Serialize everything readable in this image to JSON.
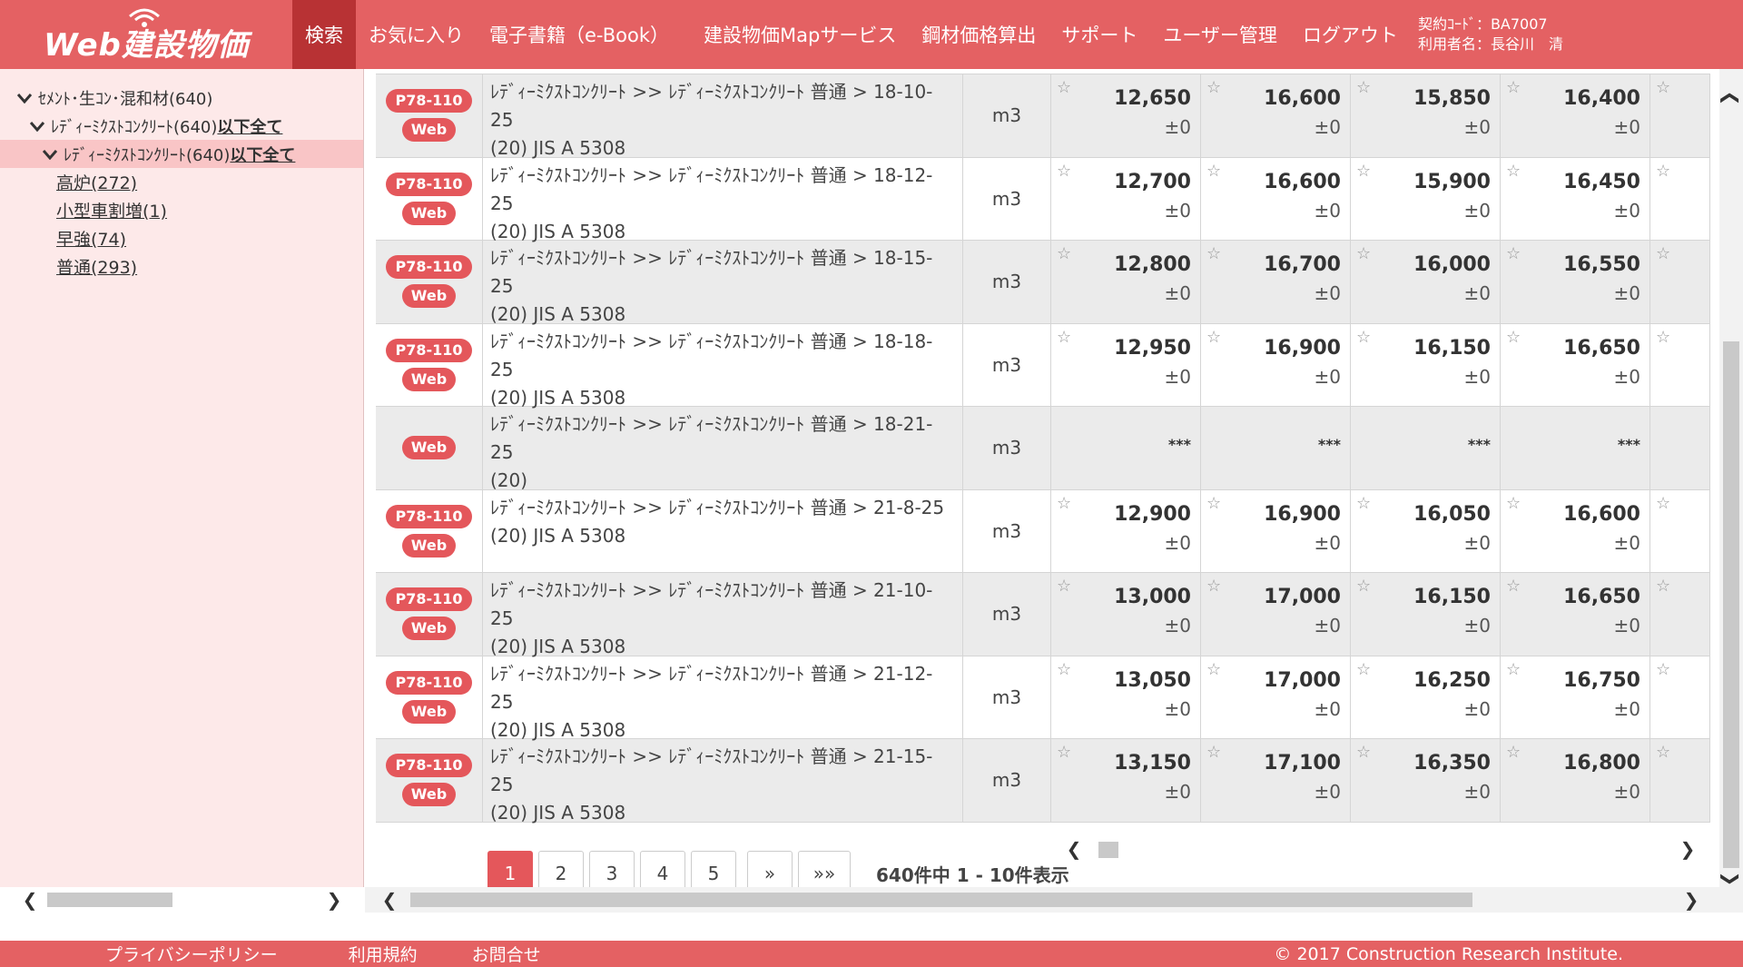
{
  "header": {
    "logo": "Web建設物価",
    "nav": [
      "検索",
      "お気に入り",
      "電子書籍（e-Book）",
      "建設物価Mapサービス",
      "鋼材価格算出",
      "サポート",
      "ユーザー管理",
      "ログアウト"
    ],
    "contract_code": "契約ｺｰﾄﾞ：BA7007",
    "user_name": "利用者名：長谷川　清"
  },
  "sidebar": {
    "root": "ｾﾒﾝﾄ･生ｺﾝ･混和材(640)",
    "level1": "ﾚﾃﾞｨｰﾐｸｽﾄｺﾝｸﾘｰﾄ(640)",
    "level1_link": " 以下全て",
    "level2": "ﾚﾃﾞｨｰﾐｸｽﾄｺﾝｸﾘｰﾄ(640)",
    "level2_link": " 以下全て",
    "leaves": [
      "高炉(272)",
      "小型車割増(1)",
      "早強(74)",
      "普通(293)"
    ]
  },
  "rows": [
    {
      "badges": [
        "P78-110",
        "Web"
      ],
      "desc1": "ﾚﾃﾞｨｰﾐｸｽﾄｺﾝｸﾘｰﾄ >> ﾚﾃﾞｨｰﾐｸｽﾄｺﾝｸﾘｰﾄ 普通 > 18-10-25",
      "desc2": "(20) JIS A 5308",
      "unit": "m3",
      "prices": [
        "12,650",
        "16,600",
        "15,850",
        "16,400"
      ],
      "diffs": [
        "±0",
        "±0",
        "±0",
        "±0"
      ]
    },
    {
      "badges": [
        "P78-110",
        "Web"
      ],
      "desc1": "ﾚﾃﾞｨｰﾐｸｽﾄｺﾝｸﾘｰﾄ >> ﾚﾃﾞｨｰﾐｸｽﾄｺﾝｸﾘｰﾄ 普通 > 18-12-25",
      "desc2": "(20) JIS A 5308",
      "unit": "m3",
      "prices": [
        "12,700",
        "16,600",
        "15,900",
        "16,450"
      ],
      "diffs": [
        "±0",
        "±0",
        "±0",
        "±0"
      ]
    },
    {
      "badges": [
        "P78-110",
        "Web"
      ],
      "desc1": "ﾚﾃﾞｨｰﾐｸｽﾄｺﾝｸﾘｰﾄ >> ﾚﾃﾞｨｰﾐｸｽﾄｺﾝｸﾘｰﾄ 普通 > 18-15-25",
      "desc2": "(20) JIS A 5308",
      "unit": "m3",
      "prices": [
        "12,800",
        "16,700",
        "16,000",
        "16,550"
      ],
      "diffs": [
        "±0",
        "±0",
        "±0",
        "±0"
      ]
    },
    {
      "badges": [
        "P78-110",
        "Web"
      ],
      "desc1": "ﾚﾃﾞｨｰﾐｸｽﾄｺﾝｸﾘｰﾄ >> ﾚﾃﾞｨｰﾐｸｽﾄｺﾝｸﾘｰﾄ 普通 > 18-18-25",
      "desc2": "(20) JIS A 5308",
      "unit": "m3",
      "prices": [
        "12,950",
        "16,900",
        "16,150",
        "16,650"
      ],
      "diffs": [
        "±0",
        "±0",
        "±0",
        "±0"
      ]
    },
    {
      "badges": [
        "Web"
      ],
      "desc1": "ﾚﾃﾞｨｰﾐｸｽﾄｺﾝｸﾘｰﾄ >> ﾚﾃﾞｨｰﾐｸｽﾄｺﾝｸﾘｰﾄ 普通 > 18-21-25",
      "desc2": "(20)",
      "unit": "m3",
      "masked": "***"
    },
    {
      "badges": [
        "P78-110",
        "Web"
      ],
      "desc1": "ﾚﾃﾞｨｰﾐｸｽﾄｺﾝｸﾘｰﾄ >> ﾚﾃﾞｨｰﾐｸｽﾄｺﾝｸﾘｰﾄ 普通 > 21-8-25",
      "desc2": "(20) JIS A 5308",
      "unit": "m3",
      "prices": [
        "12,900",
        "16,900",
        "16,050",
        "16,600"
      ],
      "diffs": [
        "±0",
        "±0",
        "±0",
        "±0"
      ]
    },
    {
      "badges": [
        "P78-110",
        "Web"
      ],
      "desc1": "ﾚﾃﾞｨｰﾐｸｽﾄｺﾝｸﾘｰﾄ >> ﾚﾃﾞｨｰﾐｸｽﾄｺﾝｸﾘｰﾄ 普通 > 21-10-25",
      "desc2": "(20) JIS A 5308",
      "unit": "m3",
      "prices": [
        "13,000",
        "17,000",
        "16,150",
        "16,650"
      ],
      "diffs": [
        "±0",
        "±0",
        "±0",
        "±0"
      ]
    },
    {
      "badges": [
        "P78-110",
        "Web"
      ],
      "desc1": "ﾚﾃﾞｨｰﾐｸｽﾄｺﾝｸﾘｰﾄ >> ﾚﾃﾞｨｰﾐｸｽﾄｺﾝｸﾘｰﾄ 普通 > 21-12-25",
      "desc2": "(20) JIS A 5308",
      "unit": "m3",
      "prices": [
        "13,050",
        "17,000",
        "16,250",
        "16,750"
      ],
      "diffs": [
        "±0",
        "±0",
        "±0",
        "±0"
      ]
    },
    {
      "badges": [
        "P78-110",
        "Web"
      ],
      "desc1": "ﾚﾃﾞｨｰﾐｸｽﾄｺﾝｸﾘｰﾄ >> ﾚﾃﾞｨｰﾐｸｽﾄｺﾝｸﾘｰﾄ 普通 > 21-15-25",
      "desc2": "(20) JIS A 5308",
      "unit": "m3",
      "prices": [
        "13,150",
        "17,100",
        "16,350",
        "16,800"
      ],
      "diffs": [
        "±0",
        "±0",
        "±0",
        "±0"
      ]
    }
  ],
  "pagination": {
    "pages": [
      "1",
      "2",
      "3",
      "4",
      "5"
    ],
    "next": "»",
    "last": "»»",
    "info": "640件中 1 - 10件表示"
  },
  "footer": {
    "privacy": "プライバシーポリシー",
    "terms": "利用規約",
    "contact": "お問合せ",
    "copyright": "© 2017 Construction Research Institute."
  },
  "colors": {
    "brand": "#e46163",
    "nav_active": "#b83234",
    "badge": "#e4575b",
    "sidebar_bg": "#fde9e9",
    "sidebar_selected": "#f9c5c6"
  }
}
